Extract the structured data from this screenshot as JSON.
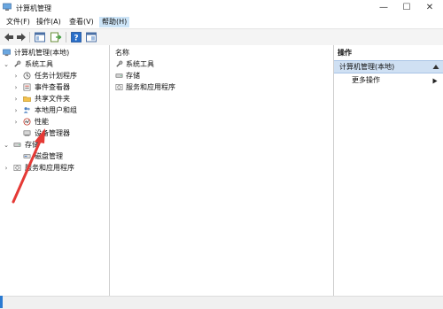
{
  "window": {
    "title": "计算机管理"
  },
  "controls": {
    "minimize": "—",
    "maximize": "☐",
    "close": "✕"
  },
  "menu": [
    "文件(F)",
    "操作(A)",
    "查看(V)",
    "帮助(H)"
  ],
  "tree": {
    "root": "计算机管理(本地)",
    "system_tools": "系统工具",
    "items": [
      "任务计划程序",
      "事件查看器",
      "共享文件夹",
      "本地用户和组",
      "性能",
      "设备管理器"
    ],
    "storage": "存储",
    "disk": "磁盘管理",
    "services": "服务和应用程序"
  },
  "list": {
    "header": "名称",
    "rows": [
      "系统工具",
      "存储",
      "服务和应用程序"
    ]
  },
  "actions": {
    "header": "操作",
    "section": "计算机管理(本地)",
    "more": "更多操作"
  },
  "colors": {
    "accent": "#2a7ad2",
    "selection": "#cce4f7",
    "annotation": "#e53935"
  }
}
